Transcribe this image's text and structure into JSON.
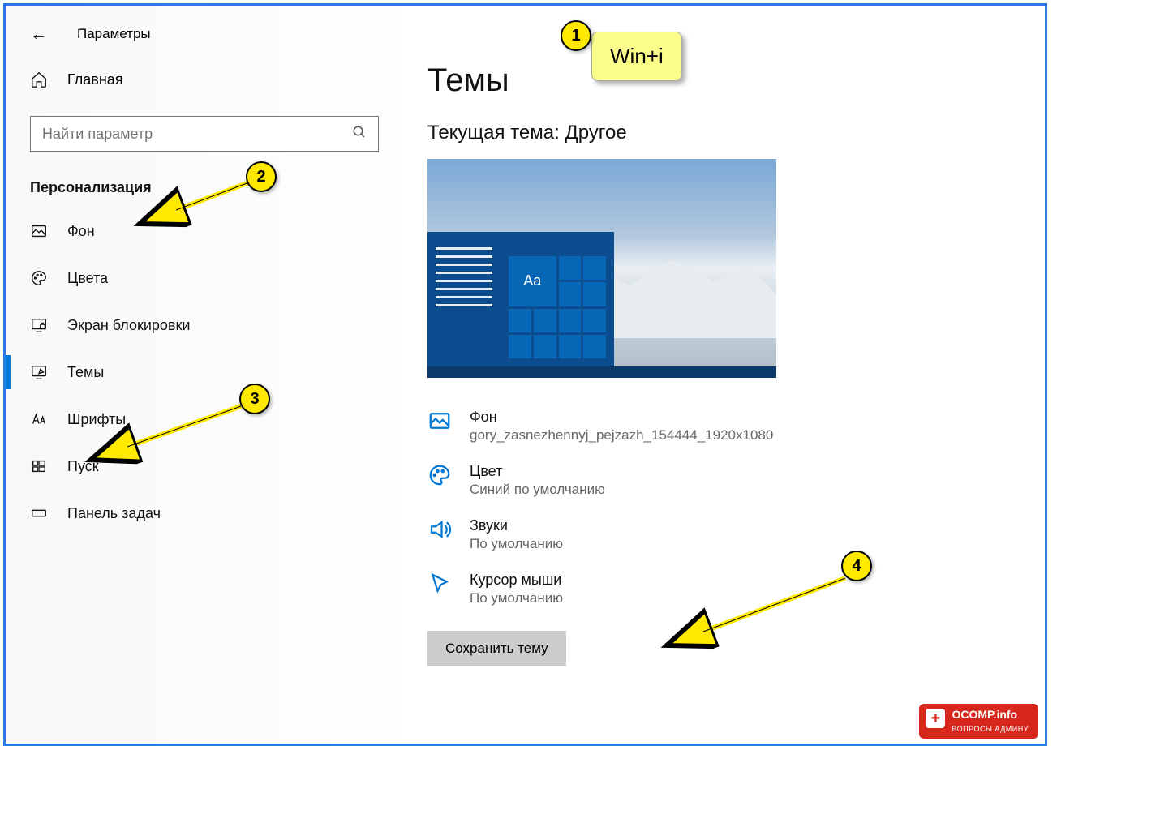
{
  "header": {
    "title": "Параметры"
  },
  "home": {
    "label": "Главная"
  },
  "search": {
    "placeholder": "Найти параметр"
  },
  "category": {
    "label": "Персонализация"
  },
  "nav": [
    {
      "label": "Фон",
      "icon": "image-icon"
    },
    {
      "label": "Цвета",
      "icon": "palette-icon"
    },
    {
      "label": "Экран блокировки",
      "icon": "lock-screen-icon"
    },
    {
      "label": "Темы",
      "icon": "themes-icon",
      "active": true
    },
    {
      "label": "Шрифты",
      "icon": "fonts-icon"
    },
    {
      "label": "Пуск",
      "icon": "start-icon"
    },
    {
      "label": "Панель задач",
      "icon": "taskbar-icon"
    }
  ],
  "page": {
    "title": "Темы",
    "subtitle": "Текущая тема: Другое",
    "preview_sample_text": "Aa"
  },
  "settings": [
    {
      "title": "Фон",
      "sub": "gory_zasnezhennyj_pejzazh_154444_1920x1080",
      "icon": "image-icon"
    },
    {
      "title": "Цвет",
      "sub": "Синий по умолчанию",
      "icon": "palette-icon"
    },
    {
      "title": "Звуки",
      "sub": "По умолчанию",
      "icon": "sound-icon"
    },
    {
      "title": "Курсор мыши",
      "sub": "По умолчанию",
      "icon": "cursor-icon"
    }
  ],
  "save_button": "Сохранить тему",
  "annotations": {
    "callout1": "Win+i",
    "badges": {
      "b1": "1",
      "b2": "2",
      "b3": "3",
      "b4": "4"
    }
  },
  "watermark": {
    "main": "OCOMP.info",
    "sub": "ВОПРОСЫ АДМИНУ"
  },
  "colors": {
    "accent": "#0078d4",
    "frame": "#2c7be5",
    "badge": "#ffe900",
    "callout": "#fafd8a"
  }
}
